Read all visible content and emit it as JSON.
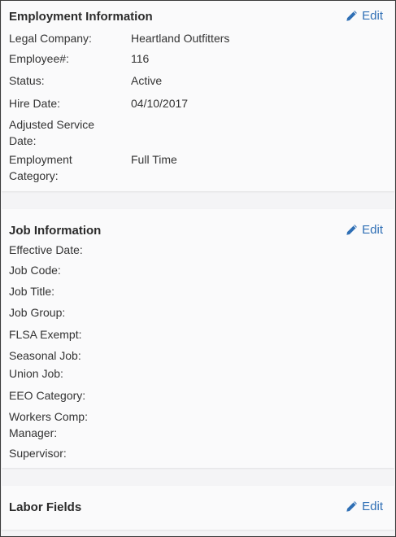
{
  "employment": {
    "title": "Employment Information",
    "edit_label": "Edit",
    "fields": [
      {
        "label": "Legal Company:",
        "value": "Heartland Outfitters"
      },
      {
        "label": "Employee#:",
        "value": "116"
      },
      {
        "label": "Status:",
        "value": "Active"
      },
      {
        "label": "Hire Date:",
        "value": "04/10/2017"
      },
      {
        "label": "Adjusted Service Date:",
        "value": ""
      },
      {
        "label": "Employment Category:",
        "value": "Full Time"
      }
    ]
  },
  "job": {
    "title": "Job Information",
    "edit_label": "Edit",
    "fields": [
      {
        "label": "Effective Date:"
      },
      {
        "label": "Job Code:"
      },
      {
        "label": "Job Title:"
      },
      {
        "label": "Job Group:"
      },
      {
        "label": "FLSA Exempt:"
      },
      {
        "label": "Seasonal Job:"
      },
      {
        "label": "Union Job:"
      },
      {
        "label": "EEO Category:"
      },
      {
        "label": "Workers Comp: Manager:"
      },
      {
        "label": "Supervisor:"
      }
    ]
  },
  "labor": {
    "title": "Labor Fields",
    "edit_label": "Edit"
  },
  "colors": {
    "link": "#2f6fb5"
  }
}
